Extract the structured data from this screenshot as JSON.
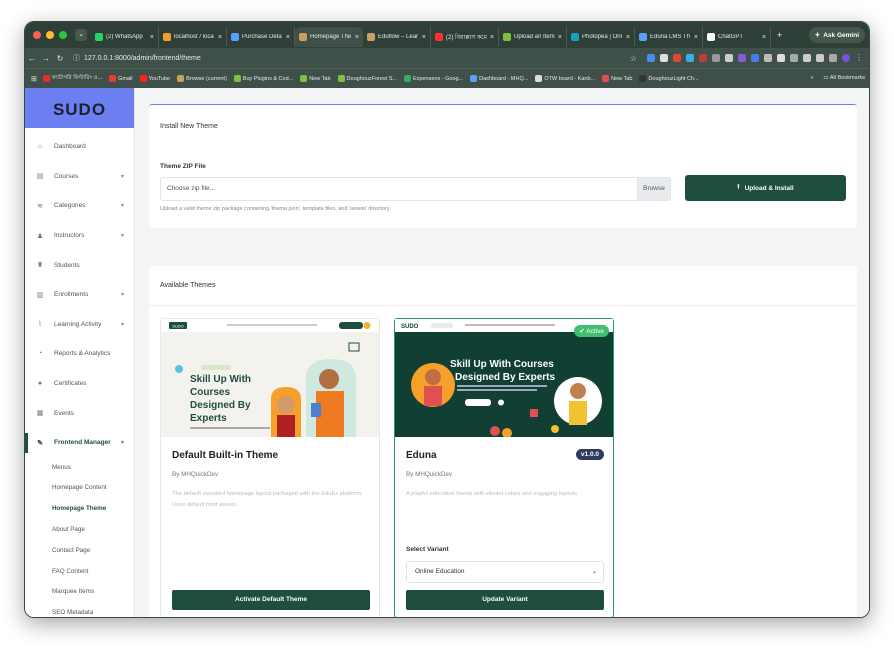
{
  "browser": {
    "tabs": [
      {
        "label": "(2) WhatsApp",
        "color": "#25d366"
      },
      {
        "label": "localhost / loca",
        "color": "#f0a030"
      },
      {
        "label": "Purchase Deta",
        "color": "#5aa0ff"
      },
      {
        "label": "Homepage The",
        "color": "#c8a060"
      },
      {
        "label": "Eduflow – Lear",
        "color": "#c8a060"
      },
      {
        "label": "(2) বিয়াল্লাস কমে",
        "color": "#ff3030"
      },
      {
        "label": "Upload an Item",
        "color": "#80c040"
      },
      {
        "label": "Photopea | Onl",
        "color": "#18a0c0"
      },
      {
        "label": "Eduna LMS Th",
        "color": "#5aa0ff"
      },
      {
        "label": "ChatGPT",
        "color": "#ffffff"
      }
    ],
    "gemini_label": "Ask Gemini",
    "url": "127.0.0.1:8000/admin/frontend/theme",
    "bookmarks": [
      {
        "label": "ক্যাটাগরি ফিল্টারিং ও...",
        "color": "#e03030"
      },
      {
        "label": "Gmail",
        "color": "#e04030"
      },
      {
        "label": "YouTube",
        "color": "#ff2020"
      },
      {
        "label": "Browse (current)",
        "color": "#c8a060"
      },
      {
        "label": "Buy Plugins & Cod...",
        "color": "#80c040"
      },
      {
        "label": "New Tab",
        "color": "#80c040"
      },
      {
        "label": "DoughouzForest S...",
        "color": "#80c040"
      },
      {
        "label": "Expensens - Goog...",
        "color": "#30b060"
      },
      {
        "label": "Dashboard - MHQ...",
        "color": "#5aa0ff"
      },
      {
        "label": "OTW board - Kanb...",
        "color": "#dddddd"
      },
      {
        "label": "New Tab",
        "color": "#e05050"
      },
      {
        "label": "DoughouzLight Ch...",
        "color": "#333333"
      }
    ],
    "all_bookmarks": "All Bookmarks"
  },
  "sidebar": {
    "logo": "SUDO",
    "items": [
      {
        "label": "Dashboard",
        "icon": "home-icon",
        "glyph": "⌂",
        "caret": ""
      },
      {
        "label": "Courses",
        "icon": "book-icon",
        "glyph": "▤",
        "caret": "▾"
      },
      {
        "label": "Categories",
        "icon": "layers-icon",
        "glyph": "≋",
        "caret": "▾"
      },
      {
        "label": "Instructors",
        "icon": "user-icon",
        "glyph": "♟",
        "caret": "▾"
      },
      {
        "label": "Students",
        "icon": "student-icon",
        "glyph": "♜",
        "caret": ""
      },
      {
        "label": "Enrollments",
        "icon": "clipboard-icon",
        "glyph": "▥",
        "caret": "▾"
      },
      {
        "label": "Learning Activity",
        "icon": "chart-icon",
        "glyph": "⌇",
        "caret": "▾"
      },
      {
        "label": "Reports & Analytics",
        "icon": "pie-icon",
        "glyph": "◔",
        "caret": ""
      },
      {
        "label": "Certificates",
        "icon": "certificate-icon",
        "glyph": "●",
        "caret": ""
      },
      {
        "label": "Events",
        "icon": "calendar-icon",
        "glyph": "▦",
        "caret": ""
      },
      {
        "label": "Frontend Manager",
        "icon": "brush-icon",
        "glyph": "✎",
        "caret": "▾"
      }
    ],
    "subitems": [
      "Menus",
      "Homepage Content",
      "Homepage Theme",
      "About Page",
      "Contact Page",
      "FAQ Content",
      "Marquee Items",
      "SEO Metadata"
    ]
  },
  "install": {
    "title": "Install New Theme",
    "zip_label": "Theme ZIP File",
    "file_placeholder": "Choose zip file...",
    "browse": "Browse",
    "upload_button": "Upload & Install",
    "help": "Upload a valid theme zip package containing 'theme.json', template files, and 'assets' directory."
  },
  "themes": {
    "title": "Available Themes",
    "items": [
      {
        "name": "Default Built-in Theme",
        "author": "By MHQuickDev",
        "description": "The default standard homepage layout packaged with the EduEx platform. Uses default front assets.",
        "preview_heading": "Skill Up With Courses Designed By Experts",
        "preview_logo": "SUDO",
        "button": "Activate Default Theme"
      },
      {
        "name": "Eduna",
        "author": "By MHQuickDev",
        "version": "v1.0.0",
        "description": "A playful education theme with vibrant colors and engaging layouts",
        "preview_heading": "Skill Up With Courses Designed By Experts",
        "preview_logo": "SUDO",
        "active_badge": "Active",
        "variant_label": "Select Variant",
        "variant_value": "Online Education",
        "button": "Update Variant"
      }
    ]
  },
  "colors": {
    "primary": "#1f4d3f",
    "logo_bg": "#6b7ff0",
    "active_badge": "#3fbf6f",
    "version_badge": "#2f3a5c"
  }
}
